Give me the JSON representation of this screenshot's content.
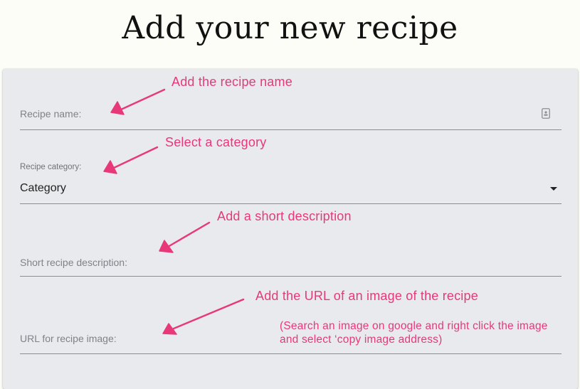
{
  "page": {
    "title": "Add your new recipe"
  },
  "form": {
    "recipe_name": {
      "label": "Recipe name:",
      "value": ""
    },
    "category": {
      "label": "Recipe category:",
      "selected": "Category"
    },
    "description": {
      "label": "Short recipe description:",
      "value": ""
    },
    "image_url": {
      "label": "URL for recipe image:",
      "value": ""
    }
  },
  "annotations": {
    "name_hint": "Add the recipe name",
    "category_hint": "Select a category",
    "description_hint": "Add a short description",
    "image_hint": "Add the URL of an image of the recipe",
    "image_subhint": "(Search an image on google and right click the image and select ‘copy image address)"
  },
  "colors": {
    "annotation": "#e8387a",
    "card_background": "#e8eaed",
    "page_background": "#fdfdf8"
  },
  "icons": {
    "recipe_name_field": "contact-card-icon",
    "category_select": "caret-down-icon",
    "annotation_pointer": "hand-drawn-arrow-icon"
  }
}
